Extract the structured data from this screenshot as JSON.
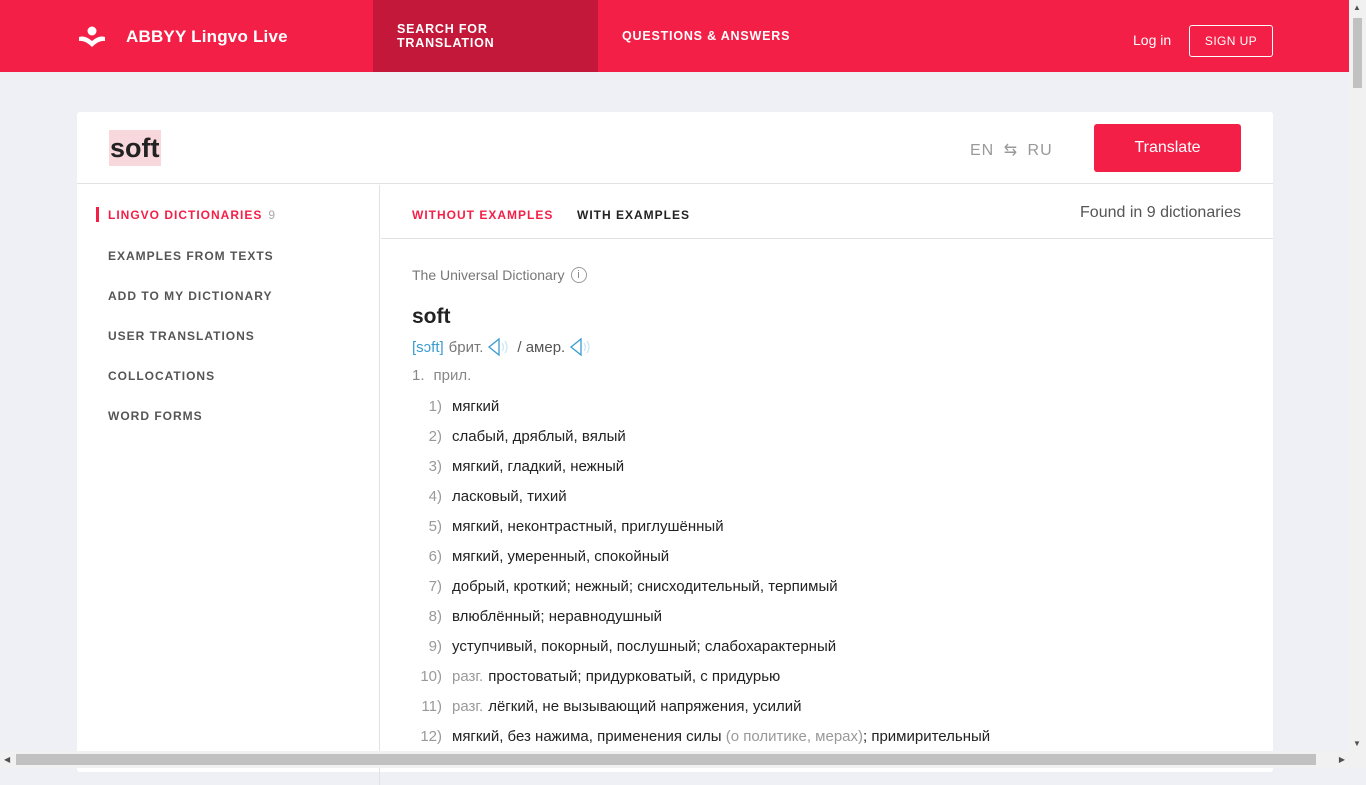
{
  "header": {
    "logo_text": "ABBYY Lingvo Live",
    "nav": [
      "SEARCH FOR TRANSLATION",
      "QUESTIONS & ANSWERS"
    ],
    "login": "Log in",
    "signup": "SIGN UP",
    "accent": "#f41f47"
  },
  "search": {
    "query": "soft",
    "from": "EN",
    "to": "RU",
    "translate": "Translate"
  },
  "sidebar": {
    "items": [
      {
        "label": "LINGVO DICTIONARIES",
        "count": "9"
      },
      {
        "label": "EXAMPLES FROM TEXTS"
      },
      {
        "label": "ADD TO MY DICTIONARY"
      },
      {
        "label": "USER TRANSLATIONS"
      },
      {
        "label": "COLLOCATIONS"
      },
      {
        "label": "WORD FORMS"
      }
    ]
  },
  "tabs": {
    "without": "WITHOUT EXAMPLES",
    "with": "WITH EXAMPLES",
    "found": "Found in 9 dictionaries"
  },
  "entry": {
    "dictionary": "The Universal Dictionary",
    "word": "soft",
    "transcription": "[sɔft]",
    "brit": "брит.",
    "amer": "/ амер.",
    "pos_num": "1.",
    "pos": "прил.",
    "meanings": [
      {
        "n": "1)",
        "text": "мягкий"
      },
      {
        "n": "2)",
        "text": "слабый, дряблый, вялый"
      },
      {
        "n": "3)",
        "text": "мягкий, гладкий, нежный"
      },
      {
        "n": "4)",
        "text": "ласковый, тихий"
      },
      {
        "n": "5)",
        "text": "мягкий, неконтрастный, приглушённый"
      },
      {
        "n": "6)",
        "text": "мягкий, умеренный, спокойный"
      },
      {
        "n": "7)",
        "text": "добрый, кроткий; нежный; снисходительный, терпимый"
      },
      {
        "n": "8)",
        "text": "влюблённый; неравнодушный"
      },
      {
        "n": "9)",
        "text": "уступчивый, покорный, послушный; слабохарактерный"
      },
      {
        "n": "10)",
        "label": "разг.",
        "text": "простоватый; придурковатый, с придурью"
      },
      {
        "n": "11)",
        "label": "разг.",
        "text": "лёгкий, не вызывающий напряжения, усилий"
      },
      {
        "n": "12)",
        "text": "мягкий, без нажима, применения силы ",
        "note": "(о политике, мерах)",
        "tail": "; примирительный"
      }
    ]
  }
}
